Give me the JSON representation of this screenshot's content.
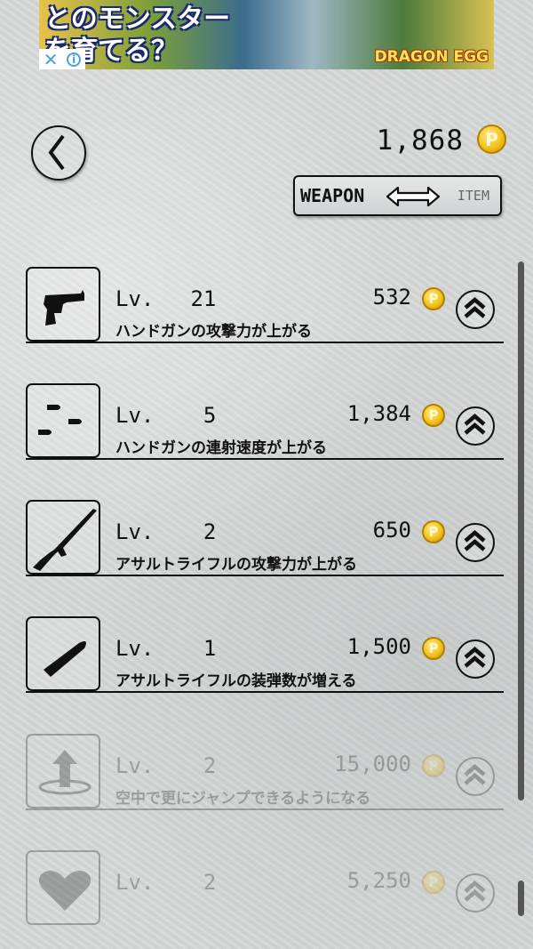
{
  "ad": {
    "headline": "とのモンスター\nを育てる？",
    "logo": "DRAGON EGG"
  },
  "header": {
    "coins": "1,868",
    "coin_symbol": "P",
    "toggle_left": "WEAPON",
    "toggle_right": "ITEM"
  },
  "upgrades": [
    {
      "icon": "handgun-icon",
      "lv_label": "Lv.",
      "level": "21",
      "price": "532",
      "coin": "P",
      "description": "ハンドガンの攻撃力が上がる",
      "enabled": true
    },
    {
      "icon": "bullets-icon",
      "lv_label": "Lv.",
      "level": "5",
      "price": "1,384",
      "coin": "P",
      "description": "ハンドガンの連射速度が上がる",
      "enabled": true
    },
    {
      "icon": "assault-rifle-icon",
      "lv_label": "Lv.",
      "level": "2",
      "price": "650",
      "coin": "P",
      "description": "アサルトライフルの攻撃力が上がる",
      "enabled": true
    },
    {
      "icon": "rifle-ammo-icon",
      "lv_label": "Lv.",
      "level": "1",
      "price": "1,500",
      "coin": "P",
      "description": "アサルトライフルの装弾数が増える",
      "enabled": true
    },
    {
      "icon": "jump-arrow-icon",
      "lv_label": "Lv.",
      "level": "2",
      "price": "15,000",
      "coin": "P",
      "description": "空中で更にジャンプできるようになる",
      "enabled": false
    },
    {
      "icon": "heart-icon",
      "lv_label": "Lv.",
      "level": "2",
      "price": "5,250",
      "coin": "P",
      "description": "",
      "enabled": false
    }
  ]
}
